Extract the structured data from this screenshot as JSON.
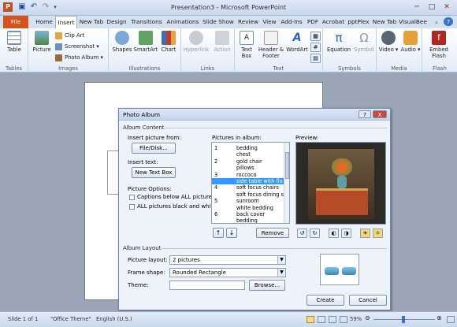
{
  "app": {
    "title": "Presentation3 - Microsoft PowerPoint",
    "tabs": [
      "File",
      "Home",
      "Insert",
      "New Tab",
      "Design",
      "Transitions",
      "Animations",
      "Slide Show",
      "Review",
      "View",
      "Add-Ins",
      "PDF",
      "Acrobat",
      "pptPlex",
      "New Tab",
      "VisualBee"
    ],
    "active_tab": "Insert",
    "accent": "#d3551d"
  },
  "ribbon": {
    "groups": [
      "Tables",
      "Images",
      "Illustrations",
      "Links",
      "Text",
      "Symbols",
      "Media",
      "Flash"
    ],
    "table": "Table",
    "picture": "Picture",
    "clip_art": "Clip Art",
    "screenshot": "Screenshot",
    "photo_album": "Photo Album",
    "shapes": "Shapes",
    "smartart": "SmartArt",
    "chart": "Chart",
    "hyperlink": "Hyperlink",
    "action": "Action",
    "text_box": "Text Box",
    "header_footer": "Header & Footer",
    "wordart": "WordArt",
    "equation": "Equation",
    "symbol": "Symbol",
    "video": "Video",
    "audio": "Audio",
    "embed_flash": "Embed Flash"
  },
  "dialog": {
    "title": "Photo Album",
    "album_content": "Album Content",
    "insert_from": "Insert picture from:",
    "file_disk": "File/Disk...",
    "insert_text": "Insert text:",
    "new_text_box": "New Text Box",
    "picture_options": "Picture Options:",
    "captions": "Captions below ALL pictures",
    "black_white": "ALL pictures black and white",
    "pictures_in_album": "Pictures in album:",
    "pictures": [
      {
        "n": "1",
        "name": "bedding"
      },
      {
        "n": "",
        "name": "chest"
      },
      {
        "n": "2",
        "name": "gold chair"
      },
      {
        "n": "",
        "name": "pillows"
      },
      {
        "n": "3",
        "name": "roccoco"
      },
      {
        "n": "",
        "name": "side table with flo"
      },
      {
        "n": "4",
        "name": "soft focus chairs"
      },
      {
        "n": "",
        "name": "soft focus dining s"
      },
      {
        "n": "5",
        "name": "sunroom"
      },
      {
        "n": "",
        "name": "white bedding"
      },
      {
        "n": "6",
        "name": "back cover"
      },
      {
        "n": "",
        "name": "bedding"
      }
    ],
    "selected_index": 5,
    "preview": "Preview:",
    "remove": "Remove",
    "album_layout": "Album Layout",
    "picture_layout_label": "Picture layout:",
    "picture_layout_value": "2 pictures",
    "frame_shape_label": "Frame shape:",
    "frame_shape_value": "Rounded Rectangle",
    "theme_label": "Theme:",
    "theme_value": "",
    "browse": "Browse...",
    "create": "Create",
    "cancel": "Cancel",
    "help": "?",
    "close": "X"
  },
  "status": {
    "slide": "Slide 1 of 1",
    "theme": "\"Office Theme\"",
    "language": "English (U.S.)",
    "zoom": "59%"
  }
}
